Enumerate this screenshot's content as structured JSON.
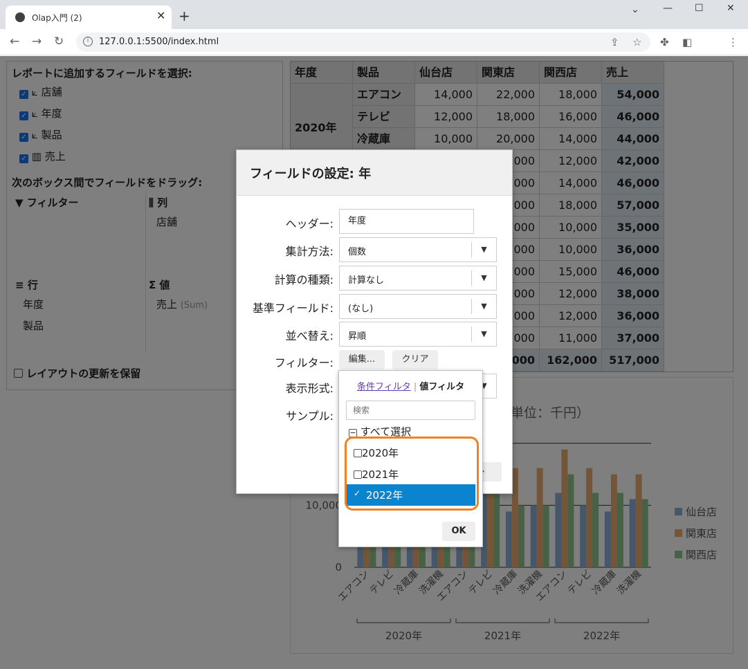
{
  "browser": {
    "tab_title": "Olap入門 (2)",
    "url": "127.0.0.1:5500/index.html"
  },
  "field_panel": {
    "heading": "レポートに追加するフィールドを選択:",
    "fields": [
      {
        "label": "店舗",
        "type": "dimension"
      },
      {
        "label": "年度",
        "type": "dimension"
      },
      {
        "label": "製品",
        "type": "dimension"
      },
      {
        "label": "売上",
        "type": "measure"
      }
    ],
    "drag_heading": "次のボックス間でフィールドをドラッグ:",
    "zones": {
      "filter": {
        "title": "フィルター",
        "items": []
      },
      "columns": {
        "title": "列",
        "items": [
          "店舗"
        ]
      },
      "rows": {
        "title": "行",
        "items": [
          "年度",
          "製品"
        ]
      },
      "values": {
        "title": "値",
        "items": [
          {
            "label": "売上",
            "agg": "(Sum)"
          }
        ]
      }
    },
    "defer_label": "レイアウトの更新を保留"
  },
  "pivot": {
    "headers": [
      "年度",
      "製品",
      "仙台店",
      "関東店",
      "関西店",
      "売上"
    ],
    "rows": [
      {
        "year": "2020年",
        "product": "エアコン",
        "v": [
          "14,000",
          "22,000",
          "18,000",
          "54,000"
        ]
      },
      {
        "year": "",
        "product": "テレビ",
        "v": [
          "12,000",
          "18,000",
          "16,000",
          "46,000"
        ]
      },
      {
        "year": "",
        "product": "冷蔵庫",
        "v": [
          "10,000",
          "20,000",
          "14,000",
          "44,000"
        ]
      },
      {
        "year": "",
        "product": "",
        "v": [
          "",
          "000",
          "12,000",
          "42,000"
        ]
      },
      {
        "year": "",
        "product": "",
        "v": [
          "",
          "000",
          "14,000",
          "46,000"
        ]
      },
      {
        "year": "",
        "product": "",
        "v": [
          "",
          "000",
          "18,000",
          "57,000"
        ]
      },
      {
        "year": "",
        "product": "",
        "v": [
          "",
          "000",
          "10,000",
          "35,000"
        ]
      },
      {
        "year": "",
        "product": "",
        "v": [
          "",
          "000",
          "10,000",
          "36,000"
        ]
      },
      {
        "year": "",
        "product": "",
        "v": [
          "",
          "000",
          "15,000",
          "46,000"
        ]
      },
      {
        "year": "",
        "product": "",
        "v": [
          "",
          "000",
          "12,000",
          "38,000"
        ]
      },
      {
        "year": "",
        "product": "",
        "v": [
          "",
          "000",
          "12,000",
          "36,000"
        ]
      },
      {
        "year": "",
        "product": "",
        "v": [
          "",
          "000",
          "11,000",
          "37,000"
        ]
      }
    ],
    "total_row": [
      "",
      "000",
      "162,000",
      "517,000"
    ]
  },
  "chart_data": {
    "type": "bar",
    "title_visible_fragment": "単位：千円）",
    "ytick_labels": [
      "0",
      "10,000"
    ],
    "ylim": [
      0,
      25000
    ],
    "categories": [
      "エアコン",
      "テレビ",
      "冷蔵庫",
      "洗濯機",
      "エアコン",
      "テレビ",
      "冷蔵庫",
      "洗濯機",
      "エアコン",
      "テレビ",
      "冷蔵庫",
      "洗濯機"
    ],
    "groups": [
      "2020年",
      "2021年",
      "2022年"
    ],
    "series": [
      {
        "name": "仙台店",
        "color": "#8faed6",
        "values": [
          14000,
          12000,
          10000,
          12000,
          15000,
          14000,
          9000,
          10000,
          12000,
          10000,
          9000,
          11000
        ]
      },
      {
        "name": "関東店",
        "color": "#e8ab6e",
        "values": [
          22000,
          18000,
          20000,
          18000,
          22000,
          20000,
          16000,
          16000,
          19000,
          16000,
          15000,
          15000
        ]
      },
      {
        "name": "関西店",
        "color": "#8dc28d",
        "values": [
          18000,
          16000,
          14000,
          12000,
          14000,
          18000,
          10000,
          10000,
          15000,
          12000,
          12000,
          11000
        ]
      }
    ],
    "legend_position": "right"
  },
  "dialog": {
    "title": "フィールドの設定: 年",
    "header_label": "ヘッダー:",
    "header_value": "年度",
    "agg_label": "集計方法:",
    "agg_value": "個数",
    "calc_label": "計算の種類:",
    "calc_value": "計算なし",
    "base_label": "基準フィールド:",
    "base_value": "(なし)",
    "sort_label": "並べ替え:",
    "sort_value": "昇順",
    "filter_label": "フィルター:",
    "edit_button": "編集...",
    "clear_button": "クリア",
    "format_label": "表示形式:",
    "sample_label": "サンプル:",
    "cancel_fragment": "ル"
  },
  "filter_popup": {
    "tab_condition": "条件フィルタ",
    "separator": "|",
    "tab_value": "値フィルタ",
    "search_placeholder": "検索",
    "select_all": "すべて選択",
    "items": [
      {
        "label": "2020年",
        "checked": false
      },
      {
        "label": "2021年",
        "checked": false
      },
      {
        "label": "2022年",
        "checked": true
      }
    ],
    "ok_button": "OK"
  },
  "colors": {
    "highlight_blue": "#0a84ce",
    "callout_orange": "#f08024"
  }
}
